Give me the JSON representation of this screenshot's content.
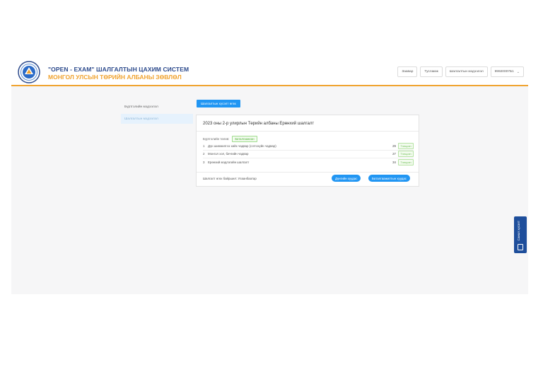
{
  "header": {
    "title": "\"OPEN - EXAM\" ШАЛГАЛТЫН ЦАХИМ СИСТЕМ",
    "subtitle": "МОНГОЛ УЛСЫН ТӨРИЙН АЛБАНЫ ЗӨВЛӨЛ",
    "nav": [
      "Заавар",
      "Тусламж",
      "Шалгалтын мэдээлэл",
      "99920007Б1"
    ]
  },
  "sidebar": {
    "items": [
      {
        "label": "Бүртгэлийн мэдээлэл",
        "active": false
      },
      {
        "label": "Шалгалтын мэдээлэл",
        "active": true
      }
    ]
  },
  "main": {
    "apply_button": "Шалгалтын хүсэлт өгөх",
    "card": {
      "title": "2023 оны 2-р улирлын Төрийн албаны Ерөнхий шалгалт",
      "status_label": "Бүртгэлийн төлөв:",
      "status_value": "Баталгаажсан",
      "exams": [
        {
          "num": "1",
          "name": "Дүн шинжилгээ хийх чадвар (сэтгэхүйн чадвар)",
          "score": "29",
          "badge": "Тэнцсэн"
        },
        {
          "num": "2",
          "name": "Монгол хэл, бичгийн чадвар",
          "score": "27",
          "badge": "Тэнцсэн"
        },
        {
          "num": "3",
          "name": "Ерөнхий мэдлэгийн шалгалт",
          "score": "34",
          "badge": "Тэнцсэн"
        }
      ],
      "location": "Шалгалт өгөх байршил: Улаанбаатар",
      "btn_result": "Дүнгийн хуудас",
      "btn_cert": "Баталгаажилтын хуудас"
    }
  },
  "floating": {
    "label": "Санал хүсэлт"
  },
  "colors": {
    "primary": "#2196f3",
    "brand_blue": "#2c4a8c",
    "brand_orange": "#f0a330",
    "success": "#52b23a",
    "floating_bg": "#1e4e9b"
  },
  "icons": [
    "logo-emblem-icon",
    "chevron-down-icon",
    "feedback-icon"
  ]
}
